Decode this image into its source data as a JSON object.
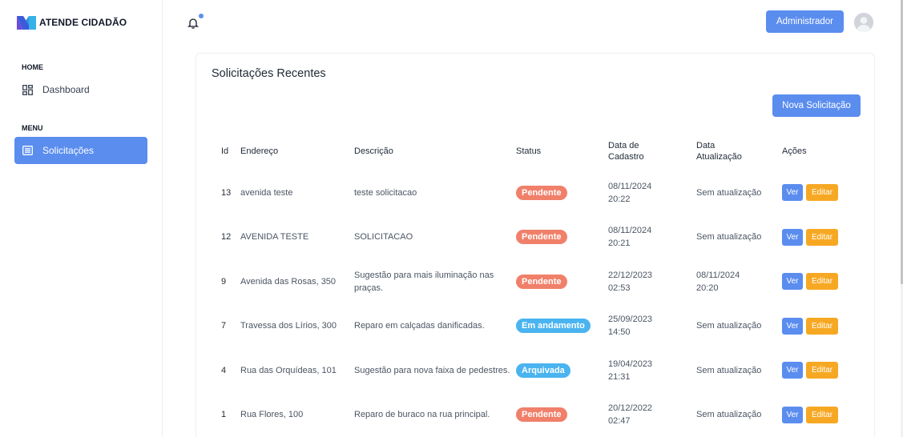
{
  "brand": {
    "name": "ATENDE CIDADÃO"
  },
  "sidebar": {
    "sections": [
      {
        "label": "HOME",
        "items": [
          {
            "label": "Dashboard",
            "icon": "dashboard-icon"
          }
        ]
      },
      {
        "label": "MENU",
        "items": [
          {
            "label": "Solicitações",
            "icon": "list-icon",
            "active": true
          }
        ]
      }
    ]
  },
  "topbar": {
    "admin_label": "Administrador",
    "accent": "#5b8def"
  },
  "card": {
    "title": "Solicitações Recentes",
    "new_button": "Nova Solicitação",
    "columns": {
      "id": "Id",
      "endereco": "Endereço",
      "descricao": "Descrição",
      "status": "Status",
      "data_cadastro_1": "Data de",
      "data_cadastro_2": "Cadastro",
      "data_atualizacao_1": "Data",
      "data_atualizacao_2": "Atualização",
      "acoes": "Ações"
    },
    "rows": [
      {
        "id": "13",
        "endereco": "avenida teste",
        "descricao": "teste solicitacao",
        "status": "Pendente",
        "cad1": "08/11/2024",
        "cad2": "20:22",
        "upd1": "Sem atualização",
        "upd2": ""
      },
      {
        "id": "12",
        "endereco": "AVENIDA TESTE",
        "descricao": "SOLICITACAO",
        "status": "Pendente",
        "cad1": "08/11/2024",
        "cad2": "20:21",
        "upd1": "Sem atualização",
        "upd2": ""
      },
      {
        "id": "9",
        "endereco": "Avenida das Rosas, 350",
        "descricao": "Sugestão para mais iluminação nas praças.",
        "status": "Pendente",
        "cad1": "22/12/2023",
        "cad2": "02:53",
        "upd1": "08/11/2024",
        "upd2": "20:20"
      },
      {
        "id": "7",
        "endereco": "Travessa dos Lírios, 300",
        "descricao": "Reparo em calçadas danificadas.",
        "status": "Em andamento",
        "cad1": "25/09/2023",
        "cad2": "14:50",
        "upd1": "Sem atualização",
        "upd2": ""
      },
      {
        "id": "4",
        "endereco": "Rua das Orquídeas, 101",
        "descricao": "Sugestão para nova faixa de pedestres.",
        "status": "Arquivada",
        "cad1": "19/04/2023",
        "cad2": "21:31",
        "upd1": "Sem atualização",
        "upd2": ""
      },
      {
        "id": "1",
        "endereco": "Rua Flores, 100",
        "descricao": "Reparo de buraco na rua principal.",
        "status": "Pendente",
        "cad1": "20/12/2022",
        "cad2": "02:47",
        "upd1": "Sem atualização",
        "upd2": ""
      }
    ],
    "actions": {
      "view": "Ver",
      "edit": "Editar"
    },
    "status_colors": {
      "Pendente": "#f0806a",
      "Em andamento": "#4ab4f0",
      "Arquivada": "#4ab4f0"
    }
  }
}
